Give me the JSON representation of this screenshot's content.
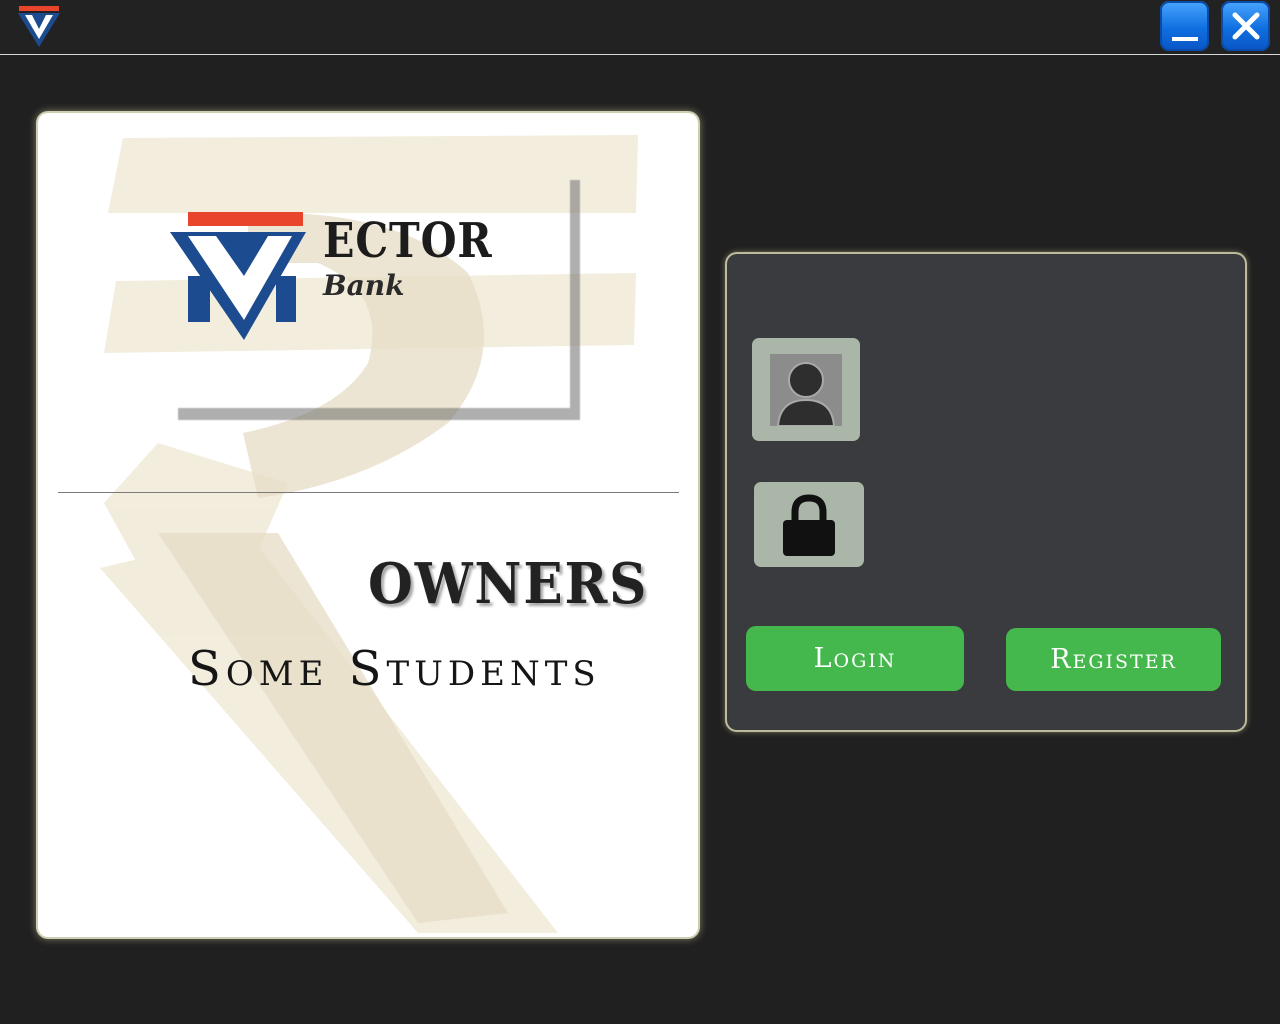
{
  "window": {
    "logo_icon": "vector-bank-logo-icon",
    "minimize_icon": "minimize-icon",
    "close_icon": "close-icon"
  },
  "branding": {
    "logo_letter_icon": "vector-v-logo",
    "logo_word": "ECTOR",
    "logo_subword": "Bank",
    "watermark_icon": "rupee-icon"
  },
  "owners": {
    "title": "OWNERS",
    "name": "Some Students"
  },
  "login": {
    "username_icon": "user-icon",
    "username_value": "",
    "password_icon": "lock-icon",
    "password_value": "",
    "login_label": "Login",
    "register_label": "Register"
  },
  "colors": {
    "background": "#202020",
    "panel": "#3a3b3e",
    "button_green": "#44b84c",
    "logo_blue": "#1d4b8f",
    "logo_red": "#e8452c"
  }
}
